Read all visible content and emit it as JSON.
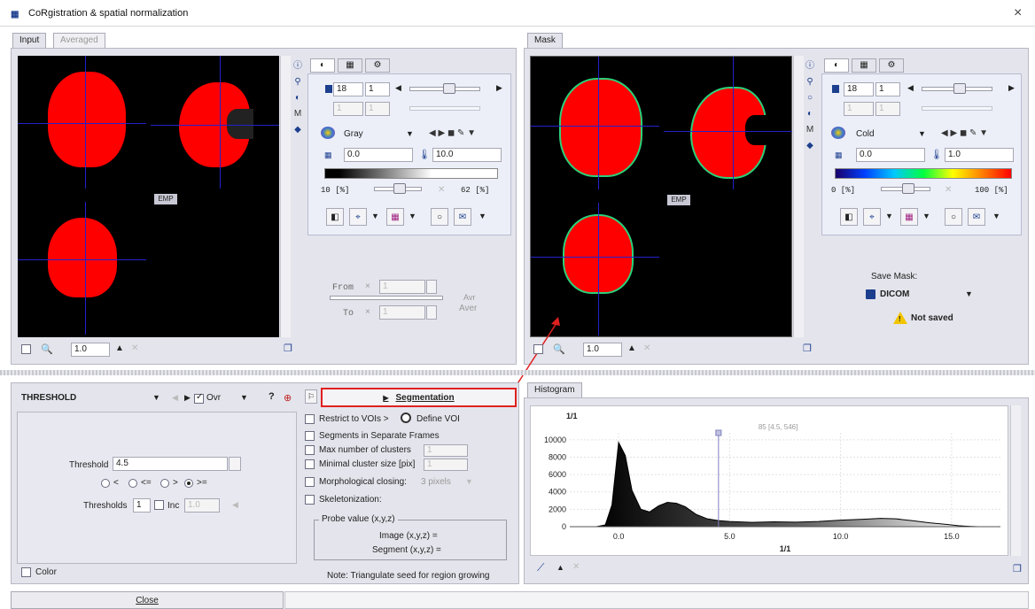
{
  "window": {
    "title": "CoRgistration & spatial normalization",
    "close_glyph": "×"
  },
  "left_tabs": {
    "input": "Input",
    "averaged": "Averaged"
  },
  "right_tabs": {
    "mask": "Mask"
  },
  "input_panel": {
    "label_emp": "EMP",
    "slice": "18",
    "frame": "1",
    "colormap": "Gray",
    "min": "0.0",
    "max": "10.0",
    "lower_pct": "10 [%]",
    "upper_pct": "62 [%]",
    "zoom": "1.0"
  },
  "mask_panel": {
    "label_emp": "EMP",
    "slice": "18",
    "frame": "1",
    "colormap": "Cold",
    "min": "0.0",
    "max": "1.0",
    "lower_pct": "0 [%]",
    "upper_pct": "100 [%]",
    "zoom": "1.0",
    "save_label": "Save Mask:",
    "format": "DICOM",
    "save_status": "Not saved"
  },
  "average": {
    "from": "From",
    "to": "To",
    "aver": "Aver",
    "avr_short": "Avr",
    "x": "×",
    "val": "1"
  },
  "threshold_panel": {
    "method": "THRESHOLD",
    "ovr": "Ovr",
    "help": "?",
    "threshold_label": "Threshold",
    "threshold_value": "4.5",
    "ops": [
      "<",
      "<=",
      ">",
      ">="
    ],
    "thresholds_label": "Thresholds",
    "thresholds_value": "1",
    "inc_label": "Inc",
    "inc_value": "1.0",
    "color_label": "Color"
  },
  "segmentation": {
    "button": "Segmentation",
    "restrict": "Restrict to VOIs >",
    "define_voi": "Define VOI",
    "separate_frames": "Segments in Separate Frames",
    "max_clusters": "Max number of clusters",
    "max_clusters_val": "1",
    "min_cluster": "Minimal cluster size [pix]",
    "min_cluster_val": "1",
    "morph": "Morphological closing:",
    "morph_val": "3 pixels",
    "skeleton": "Skeletonization:",
    "probe_title": "Probe value (x,y,z)",
    "image_probe": "Image (x,y,z) =",
    "segment_probe": "Segment (x,y,z) =",
    "note": "Note: Triangulate seed for region growing"
  },
  "histogram": {
    "tab": "Histogram",
    "title": "1/1",
    "marker_text": "85 [4.5, 546]",
    "xlabel": "1/1",
    "y_ticks": [
      "10000",
      "8000",
      "6000",
      "4000",
      "2000",
      "0"
    ],
    "x_ticks": [
      "0.0",
      "5.0",
      "10.0",
      "15.0"
    ]
  },
  "chart_data": {
    "type": "area",
    "title": "1/1",
    "xlabel": "1/1",
    "ylabel": "",
    "xlim": [
      -2.2,
      17.2
    ],
    "ylim": [
      0,
      10800
    ],
    "x": [
      -1.0,
      -0.6,
      -0.3,
      0.0,
      0.3,
      0.6,
      1.0,
      1.4,
      1.8,
      2.2,
      2.6,
      3.0,
      3.5,
      4.0,
      4.5,
      5.0,
      6.0,
      7.0,
      8.0,
      9.0,
      10.0,
      11.0,
      11.8,
      12.5,
      13.2,
      14.0,
      14.8,
      15.3,
      15.6,
      15.9,
      16.2
    ],
    "y": [
      0,
      200,
      2500,
      9700,
      8200,
      4200,
      2000,
      1700,
      2400,
      2800,
      2700,
      2300,
      1400,
      900,
      700,
      600,
      500,
      560,
      520,
      600,
      750,
      850,
      950,
      900,
      700,
      450,
      250,
      120,
      70,
      30,
      0
    ],
    "marker_x": 4.5,
    "grid": true
  },
  "close_button": "Close",
  "colors": {
    "accent": "#e02020",
    "panel": "#e4e4ec",
    "brain": "#ff0000",
    "crosshair": "#2222cc"
  }
}
